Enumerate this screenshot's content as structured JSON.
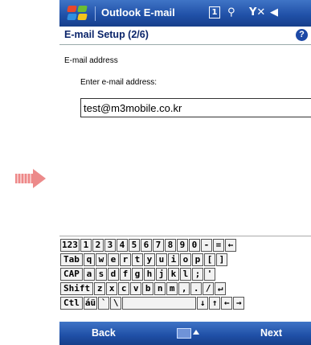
{
  "title_bar": {
    "app_title": "Outlook E-mail",
    "icons": [
      "windows-start-icon",
      "notification-icon",
      "connectivity-icon",
      "signal-off-icon",
      "volume-muted-icon"
    ],
    "notification_glyph": "1",
    "connectivity_glyph": "⚲",
    "signal_glyph": "Y✕",
    "volume_glyph": "◀︎"
  },
  "header": {
    "title": "E-mail Setup (2/6)",
    "help_glyph": "?"
  },
  "form": {
    "section_label": "E-mail address",
    "prompt_label": "Enter e-mail address:",
    "email_value": "test@m3mobile.co.kr"
  },
  "keyboard": {
    "rows": [
      [
        "123",
        "1",
        "2",
        "3",
        "4",
        "5",
        "6",
        "7",
        "8",
        "9",
        "0",
        "-",
        "=",
        "←"
      ],
      [
        "Tab",
        "q",
        "w",
        "e",
        "r",
        "t",
        "y",
        "u",
        "i",
        "o",
        "p",
        "[",
        "]"
      ],
      [
        "CAP",
        "a",
        "s",
        "d",
        "f",
        "g",
        "h",
        "j",
        "k",
        "l",
        ";",
        "'"
      ],
      [
        "Shift",
        "z",
        "x",
        "c",
        "v",
        "b",
        "n",
        "m",
        ",",
        ".",
        "/",
        "↵"
      ],
      [
        "Ctl",
        "áü",
        "`",
        "\\",
        " ",
        "↓",
        "↑",
        "←",
        "→"
      ]
    ]
  },
  "menu_bar": {
    "left_softkey": "Back",
    "right_softkey": "Next"
  },
  "colors": {
    "bar_blue": "#1f4fa6",
    "header_text": "#0a246a",
    "arrow_pink": "#ec8a8a"
  }
}
